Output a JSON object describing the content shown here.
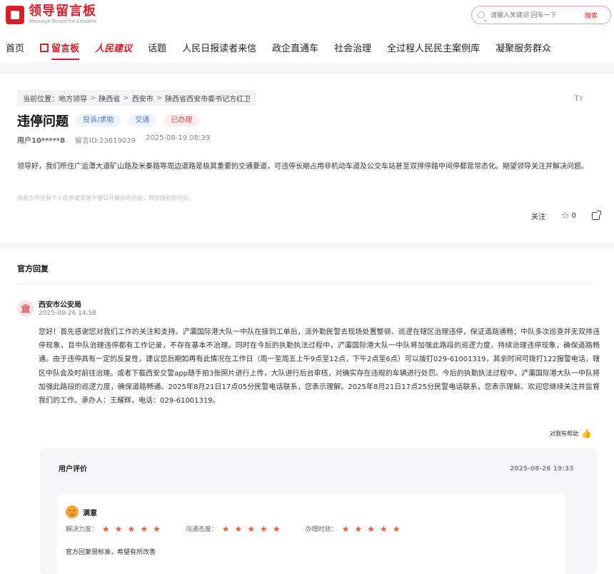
{
  "brand": {
    "title": "领导留言板",
    "subtitle": "Message Board for Leaders",
    "color": "#d81e2a"
  },
  "search": {
    "placeholder": "请输入关键词 回车一下",
    "button": "搜索"
  },
  "nav": {
    "items": [
      {
        "label": "首页",
        "active": false
      },
      {
        "label": "留言板",
        "active": true
      },
      {
        "label": "人民建议",
        "active": false
      },
      {
        "label": "话题",
        "active": false
      },
      {
        "label": "人民日报读者来信",
        "active": false
      },
      {
        "label": "政企直通车",
        "active": false
      },
      {
        "label": "社会治理",
        "active": false
      },
      {
        "label": "全过程人民民主案例库",
        "active": false
      },
      {
        "label": "凝聚服务群众",
        "active": false
      }
    ]
  },
  "message": {
    "breadcrumb": [
      "当前位置：地方领导",
      "陕西省",
      "西安市",
      "陕西省西安市委书记方红卫"
    ],
    "font_icon": "Tт",
    "title": "违停问题",
    "tags": [
      {
        "label": "投诉/求助",
        "style": "blue"
      },
      {
        "label": "交通",
        "style": "blue"
      },
      {
        "label": "已办理",
        "style": "red"
      }
    ],
    "user": "用户10*****8",
    "message_id": "留言ID:23619039",
    "time": "2025-08-19 08:39",
    "content": "领导好，我们所住广运潭大道矿山路及米秦路等周边道路是极其重要的交通要道，可违停长期占用非机动车道及公交车站甚至双排停路中间停都是常态化。期望领导关注并解决问题。",
    "notice": "该留言中含有个人信息或其他不便公开展示的内容，仅办理机构可见。",
    "follow_label": "关注",
    "star_count": "0"
  },
  "reply": {
    "heading": "官方回复",
    "org_icon": "bank-icon",
    "org": "西安市公安局",
    "time": "2025-08-26 14:58",
    "content": "您好！首先感谢您对我们工作的关注和支持。浐灞国际港大队一中队在接到工单后，派外勤民警去现场处置整顿、巡逻在辖区治理违停，保证道路通畅；中队多次巡查并无双排违停现象，且中队治理违停都有工作记录，不存在基本不治理。同时在今后的执勤执法过程中，浐灞国际港大队一中队将加强此路段的巡逻力度，持续治理违停现象，确保道路畅通。由于违停具有一定的反复性，建议您后期如再有此情况在工作日（周一至周五上午9点至12点，下午2点至6点）可以拨打029-61001319，其余时间可拨打122报警电话，辖区中队会及时前往治理。或者下载西安交警app随手拍3张照片进行上传，大队进行后台审核，对确实存在违规的车辆进行处罚。今后的执勤执法过程中，浐灞国际港大队一中队将加强此路段的巡逻力度，确保道路畅通。2025年8月21日17点05分民警电话联系，您表示理解。2025年8月21日17点25分民警电话联系，您表示理解。欢迎您继续关注并监督我们的工作。承办人：王耀辉，电话：029-61001319。",
    "helpful_label": "对我有帮助"
  },
  "evaluation": {
    "title": "用户评价",
    "time": "2025-08-26 19:33",
    "level": "满意",
    "ratings": [
      {
        "label": "解决力度：",
        "stars": 5
      },
      {
        "label": "沟通态度：",
        "stars": 5
      },
      {
        "label": "办理时效：",
        "stars": 5
      }
    ],
    "star_color": "#f05a3b",
    "comment": "官方回复很标准，希望有所改善"
  }
}
